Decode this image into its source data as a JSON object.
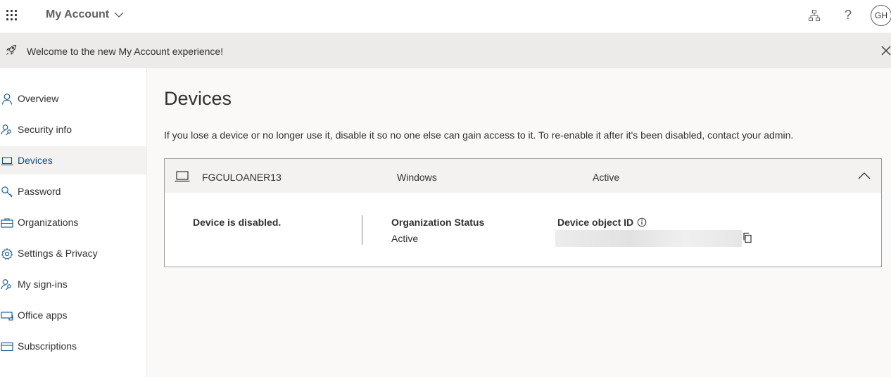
{
  "header": {
    "app_title": "My Account",
    "avatar_initials": "GH",
    "help_symbol": "?"
  },
  "banner": {
    "message": "Welcome to the new My Account experience!"
  },
  "sidebar": {
    "items": [
      {
        "label": "Overview",
        "icon": "person-icon"
      },
      {
        "label": "Security info",
        "icon": "person-key-icon"
      },
      {
        "label": "Devices",
        "icon": "laptop-icon",
        "active": true
      },
      {
        "label": "Password",
        "icon": "key-icon"
      },
      {
        "label": "Organizations",
        "icon": "briefcase-icon"
      },
      {
        "label": "Settings & Privacy",
        "icon": "gear-icon"
      },
      {
        "label": "My sign-ins",
        "icon": "person-key-icon"
      },
      {
        "label": "Office apps",
        "icon": "office-apps-icon"
      },
      {
        "label": "Subscriptions",
        "icon": "card-icon"
      }
    ]
  },
  "main": {
    "title": "Devices",
    "description": "If you lose a device or no longer use it, disable it so no one else can gain access to it. To re-enable it after it's been disabled, contact your admin.",
    "device": {
      "name": "FGCULOANER13",
      "os": "Windows",
      "state": "Active",
      "disabled_message": "Device is disabled.",
      "org_status_label": "Organization Status",
      "org_status_value": "Active",
      "object_id_label": "Device object ID"
    }
  },
  "colors": {
    "accent": "#0f548c",
    "banner_bg": "#edebe9",
    "active_nav_bg": "#f3f2f1"
  }
}
